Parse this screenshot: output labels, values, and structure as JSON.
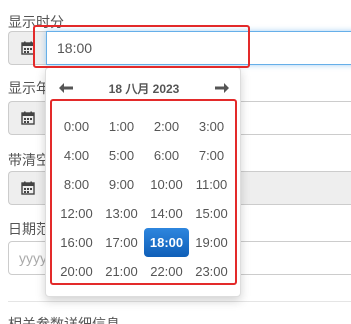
{
  "form": {
    "show_hm_label": "显示时分",
    "show_hm_value": "18:00",
    "show_year_label": "显示年",
    "clear_label": "带清空",
    "date_range_label": "日期范",
    "date_range_placeholder": "yyyy-",
    "bottom_label": "相关参数详细信息"
  },
  "picker": {
    "title": "18 八月 2023",
    "prev_icon": "arrow-left-icon",
    "next_icon": "arrow-right-icon",
    "hours": [
      "0:00",
      "1:00",
      "2:00",
      "3:00",
      "4:00",
      "5:00",
      "6:00",
      "7:00",
      "8:00",
      "9:00",
      "10:00",
      "11:00",
      "12:00",
      "13:00",
      "14:00",
      "15:00",
      "16:00",
      "17:00",
      "18:00",
      "19:00",
      "20:00",
      "21:00",
      "22:00",
      "23:00"
    ],
    "selected": "18:00"
  },
  "colors": {
    "highlight": "#e32a2a",
    "selected": "#1a6bc7"
  }
}
